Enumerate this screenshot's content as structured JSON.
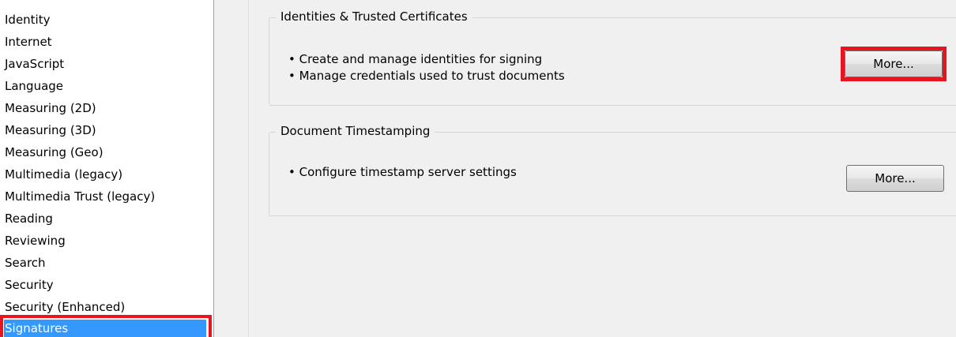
{
  "sidebar": {
    "items": [
      "Identity",
      "Internet",
      "JavaScript",
      "Language",
      "Measuring (2D)",
      "Measuring (3D)",
      "Measuring (Geo)",
      "Multimedia (legacy)",
      "Multimedia Trust (legacy)",
      "Reading",
      "Reviewing",
      "Search",
      "Security",
      "Security (Enhanced)",
      "Signatures"
    ],
    "selected": "Signatures"
  },
  "identities_group": {
    "title": "Identities & Trusted Certificates",
    "bullets": [
      "• Create and manage identities for signing",
      "• Manage credentials used to trust documents"
    ],
    "button_label": "More..."
  },
  "timestamp_group": {
    "title": "Document Timestamping",
    "bullets": [
      "• Configure timestamp server settings"
    ],
    "button_label": "More..."
  },
  "colors": {
    "selection": "#3399ff",
    "highlight_annotation": "#e8141f"
  }
}
